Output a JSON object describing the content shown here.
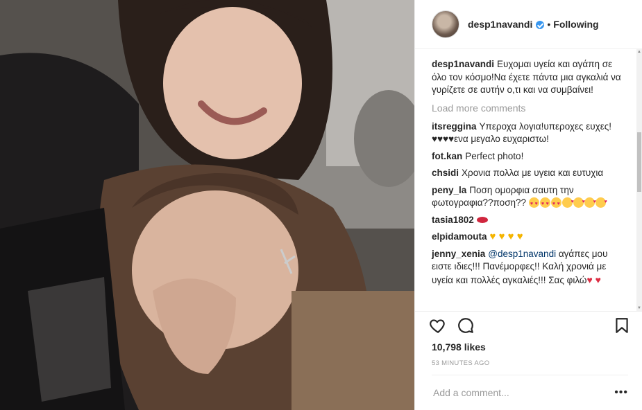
{
  "post": {
    "username": "desp1navandi",
    "dot": "•",
    "follow_label": "Following",
    "caption": "Ευχομαι υγεία και αγάπη σε όλο τον κόσμο!Να έχετε πάντα μια αγκαλιά να γυρίζετε σε αυτήν ο,τι και να συμβαίνει!",
    "load_more": "Load more comments",
    "comments": [
      {
        "user": "itsreggina",
        "text": "Υπεροχα λογια!υπεροχες ευχες! ♥♥♥♥ενα μεγαλο ευχαριστω!"
      },
      {
        "user": "fot.kan",
        "text": "Perfect photo!"
      },
      {
        "user": "chsidi",
        "text": "Χρονια πολλα με υγεια και ευτυχια"
      },
      {
        "user": "peny_la",
        "text": "Ποση ομορφια σαυτη την φωτογραφια??ποση??"
      },
      {
        "user": "tasia1802",
        "text": ""
      },
      {
        "user": "elpidamouta",
        "text": ""
      },
      {
        "user": "jenny_xenia",
        "mention": "@desp1navandi",
        "text": " αγάπες μου ειστε ιδιες!!! Πανέμορφες!! Καλή χρονιά με υγεία και πολλές αγκαλιές!!! Σας φιλώ"
      }
    ],
    "likes": "10,798 likes",
    "time": "53 MINUTES AGO",
    "add_comment_placeholder": "Add a comment...",
    "more_label": "•••"
  },
  "icons": {
    "like": "heart-outline-icon",
    "comment": "speech-bubble-icon",
    "save": "bookmark-icon",
    "verified": "verified-badge-icon"
  },
  "colors": {
    "link": "#003569",
    "verified": "#3897f0",
    "muted": "#999999"
  }
}
